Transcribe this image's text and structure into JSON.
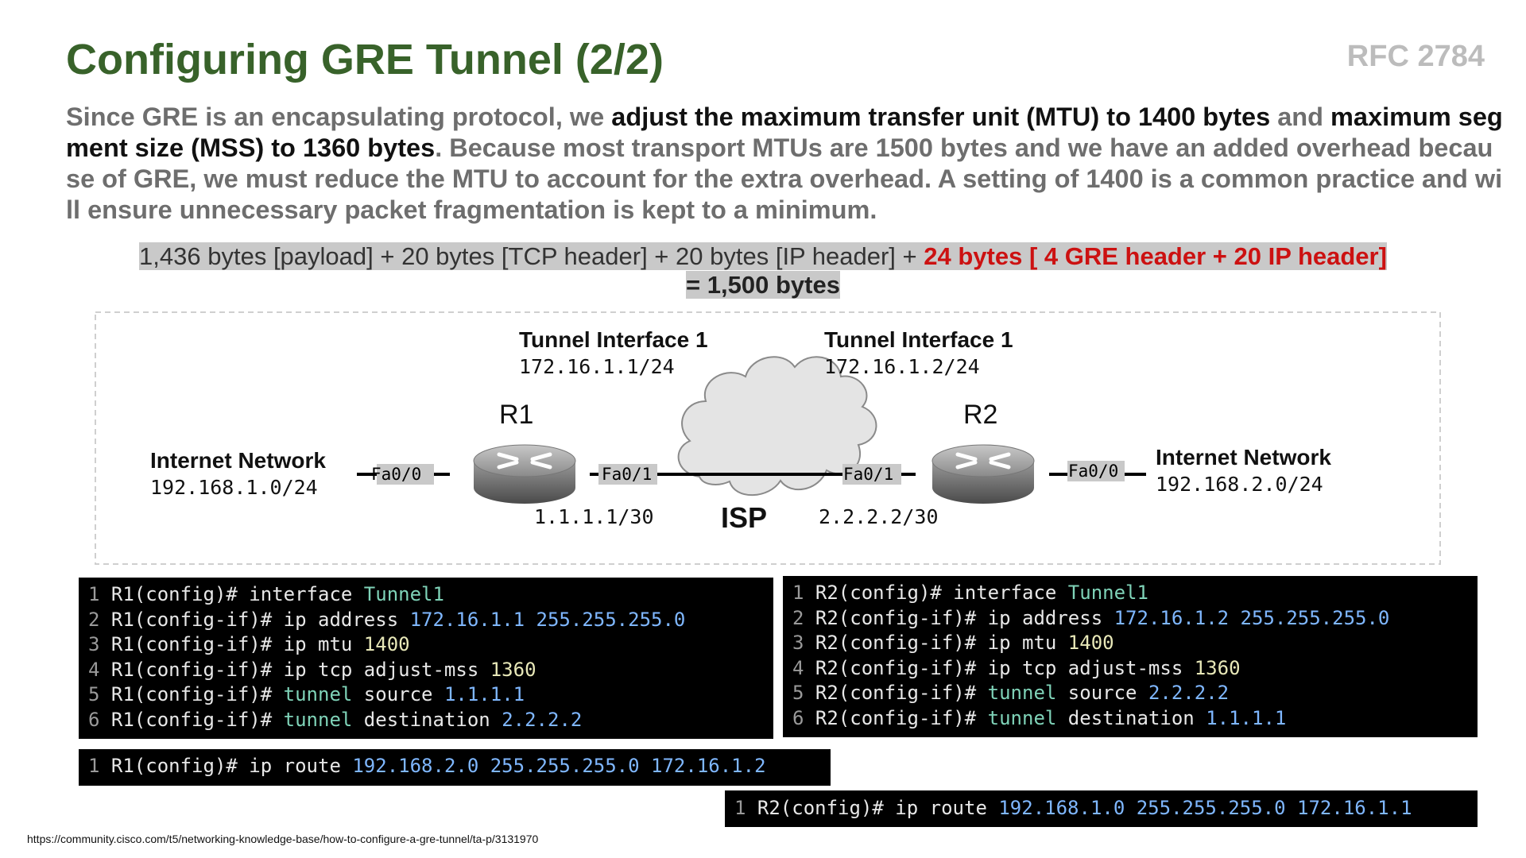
{
  "slide": {
    "title": "Configuring GRE Tunnel (2/2)",
    "rfc": "RFC 2784",
    "description": [
      {
        "text": "Since GRE is an encapsulating protocol, we ",
        "bold": false
      },
      {
        "text": "adjust the maximum transfer unit (MTU) to 1400 bytes",
        "bold": true
      },
      {
        "text": " and ",
        "bold": false
      },
      {
        "text": "maximum segment size (MSS) to 1360 bytes",
        "bold": true
      },
      {
        "text": ". Because most transport MTUs are 1500 bytes and we have an added overhead because of GRE, we must reduce the MTU to account for the extra overhead. A setting of 1400 is a common practice and will ensure unnecessary packet fragmentation is kept to a minimum.",
        "bold": false
      }
    ],
    "formula": {
      "plain": "1,436 bytes [payload] + 20 bytes [TCP header] + 20 bytes [IP header] + ",
      "red": "24 bytes [ 4 GRE header + 20 IP header]",
      "total": "= 1,500 bytes"
    },
    "source": "https://community.cisco.com/t5/networking-knowledge-base/how-to-configure-a-gre-tunnel/ta-p/3131970"
  },
  "diagram": {
    "tunnel_left": {
      "title": "Tunnel Interface 1",
      "ip": "172.16.1.1/24"
    },
    "tunnel_right": {
      "title": "Tunnel Interface 1",
      "ip": "172.16.1.2/24"
    },
    "r1_label": "R1",
    "r2_label": "R2",
    "isp_label": "ISP",
    "left_net": {
      "title": "Internet Network",
      "ip": "192.168.1.0/24"
    },
    "right_net": {
      "title": "Internet Network",
      "ip": "192.168.2.0/24"
    },
    "r1_fa00": "Fa0/0",
    "r1_fa01": "Fa0/1",
    "r2_fa01": "Fa0/1",
    "r2_fa00": "Fa0/0",
    "r1_wan_ip": "1.1.1.1/30",
    "r2_wan_ip": "2.2.2.2/30"
  },
  "code": {
    "r1": [
      [
        {
          "t": "R1(config)# interface ",
          "c": ""
        },
        {
          "t": "Tunnel1",
          "c": "kw"
        }
      ],
      [
        {
          "t": "R1(config-if)# ip address ",
          "c": ""
        },
        {
          "t": "172.16.1.1 255.255.255.0",
          "c": "num"
        }
      ],
      [
        {
          "t": "R1(config-if)# ip mtu ",
          "c": ""
        },
        {
          "t": "1400",
          "c": "val"
        }
      ],
      [
        {
          "t": "R1(config-if)# ip tcp adjust-mss ",
          "c": ""
        },
        {
          "t": "1360",
          "c": "val"
        }
      ],
      [
        {
          "t": "R1(config-if)# ",
          "c": ""
        },
        {
          "t": "tunnel",
          "c": "kw"
        },
        {
          "t": " source ",
          "c": ""
        },
        {
          "t": "1.1.1.1",
          "c": "num"
        }
      ],
      [
        {
          "t": "R1(config-if)# ",
          "c": ""
        },
        {
          "t": "tunnel",
          "c": "kw"
        },
        {
          "t": " destination ",
          "c": ""
        },
        {
          "t": "2.2.2.2",
          "c": "num"
        }
      ]
    ],
    "r2": [
      [
        {
          "t": "R2(config)# interface ",
          "c": ""
        },
        {
          "t": "Tunnel1",
          "c": "kw"
        }
      ],
      [
        {
          "t": "R2(config-if)# ip address ",
          "c": ""
        },
        {
          "t": "172.16.1.2 255.255.255.0",
          "c": "num"
        }
      ],
      [
        {
          "t": "R2(config-if)# ip mtu ",
          "c": ""
        },
        {
          "t": "1400",
          "c": "val"
        }
      ],
      [
        {
          "t": "R2(config-if)# ip tcp adjust-mss ",
          "c": ""
        },
        {
          "t": "1360",
          "c": "val"
        }
      ],
      [
        {
          "t": "R2(config-if)# ",
          "c": ""
        },
        {
          "t": "tunnel",
          "c": "kw"
        },
        {
          "t": " source ",
          "c": ""
        },
        {
          "t": "2.2.2.2",
          "c": "num"
        }
      ],
      [
        {
          "t": "R2(config-if)# ",
          "c": ""
        },
        {
          "t": "tunnel",
          "c": "kw"
        },
        {
          "t": " destination ",
          "c": ""
        },
        {
          "t": "1.1.1.1",
          "c": "num"
        }
      ]
    ],
    "r1_route": [
      [
        {
          "t": "R1(config)# ip route ",
          "c": ""
        },
        {
          "t": "192.168.2.0 255.255.255.0 172.16.1.2",
          "c": "num"
        }
      ]
    ],
    "r2_route": [
      [
        {
          "t": "R2(config)# ip route ",
          "c": ""
        },
        {
          "t": "192.168.1.0 255.255.255.0 172.16.1.1",
          "c": "num"
        }
      ]
    ]
  }
}
